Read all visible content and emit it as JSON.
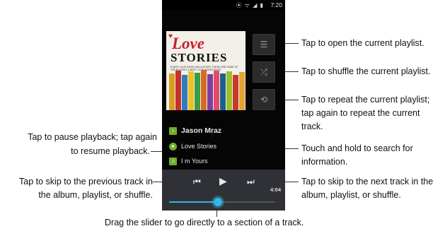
{
  "status_bar": {
    "icons": "⦿ ᯤ ◢ ▮",
    "time": "7:20"
  },
  "album_art": {
    "title_line1": "Love",
    "title_line2": "STORIES",
    "tagline": "EVERY LOVE SONG HAS A STORY. THESE ARE SOME OF THE BIGGEST & BEST LOVE SONGS EVER"
  },
  "now_playing": {
    "artist": "Jason Mraz",
    "album": "Love Stories",
    "track": "I m Yours"
  },
  "player": {
    "elapsed": "4:04",
    "progress": 0.46
  },
  "annotations": {
    "playlist": "Tap to open the current playlist.",
    "shuffle": "Tap to shuffle the current playlist.",
    "repeat_1": "Tap to repeat the current playlist;",
    "repeat_2": "tap again to repeat the current",
    "repeat_3": "track.",
    "search_1": "Touch and hold to search for",
    "search_2": "information.",
    "pause_1": "Tap to pause playback; tap again",
    "pause_2": "to resume playback.",
    "prev_1": "Tap to skip to the previous track in",
    "prev_2": "the album, playlist, or shuffle.",
    "next_1": "Tap to skip to the next track in the",
    "next_2": "album, playlist, or shuffle.",
    "slider": "Drag the slider to go directly to a section of a track."
  },
  "colors": {
    "accent": "#33b5e5",
    "icon_green": "#6fae2f",
    "controls_bg": "#2f3136"
  }
}
